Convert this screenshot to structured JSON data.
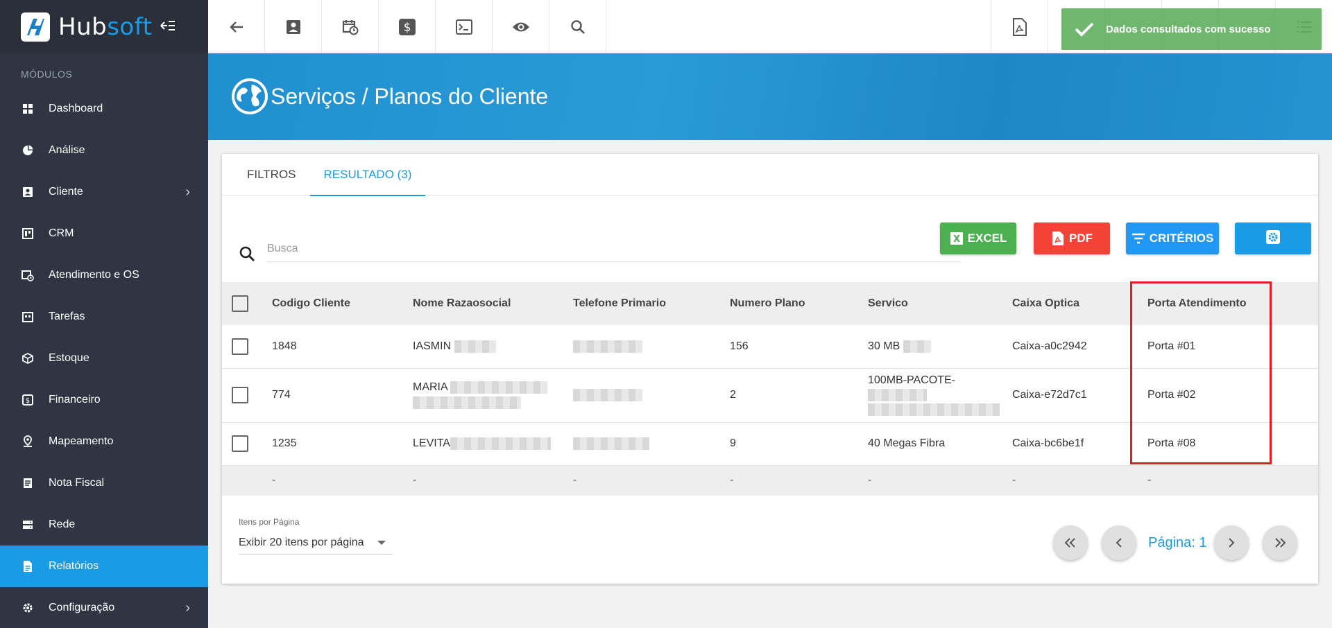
{
  "brand": {
    "hub": "Hub",
    "soft": "soft"
  },
  "sidebar": {
    "section_title": "MÓDULOS",
    "items": [
      {
        "label": "Dashboard",
        "icon": "dashboard-icon"
      },
      {
        "label": "Análise",
        "icon": "pie-chart-icon"
      },
      {
        "label": "Cliente",
        "icon": "contact-card-icon",
        "has_submenu": true
      },
      {
        "label": "CRM",
        "icon": "crm-board-icon"
      },
      {
        "label": "Atendimento e OS",
        "icon": "calendar-clock-icon"
      },
      {
        "label": "Tarefas",
        "icon": "tasks-icon"
      },
      {
        "label": "Estoque",
        "icon": "box-icon"
      },
      {
        "label": "Financeiro",
        "icon": "money-icon"
      },
      {
        "label": "Mapeamento",
        "icon": "map-pin-icon"
      },
      {
        "label": "Nota Fiscal",
        "icon": "invoice-icon"
      },
      {
        "label": "Rede",
        "icon": "server-icon"
      },
      {
        "label": "Relatórios",
        "icon": "report-icon",
        "active": true
      },
      {
        "label": "Configuração",
        "icon": "gear-icon",
        "has_submenu": true
      }
    ]
  },
  "toast": {
    "message": "Dados consultados com sucesso"
  },
  "banner": {
    "title": "Serviços / Planos do Cliente"
  },
  "tabs": [
    {
      "label": "FILTROS",
      "active": false
    },
    {
      "label": "RESULTADO (3)",
      "active": true
    }
  ],
  "search": {
    "placeholder": "Busca"
  },
  "actions": {
    "excel": "EXCEL",
    "pdf": "PDF",
    "criterios": "CRITÉRIOS"
  },
  "table": {
    "columns": [
      "Codigo Cliente",
      "Nome Razaosocial",
      "Telefone Primario",
      "Numero Plano",
      "Servico",
      "Caixa Optica",
      "Porta Atendimento"
    ],
    "rows": [
      {
        "codigo": "1848",
        "nome": "IASMIN",
        "telefone": "",
        "plano": "156",
        "servico": "30 MB",
        "caixa": "Caixa-a0c2942",
        "porta": "Porta #01"
      },
      {
        "codigo": "774",
        "nome": "MARIA",
        "telefone": "",
        "plano": "2",
        "servico": "100MB-PACOTE-",
        "caixa": "Caixa-e72d7c1",
        "porta": "Porta #02"
      },
      {
        "codigo": "1235",
        "nome": "LEVITA",
        "telefone": "",
        "plano": "9",
        "servico": "40 Megas Fibra",
        "caixa": "Caixa-bc6be1f",
        "porta": "Porta #08"
      }
    ],
    "footer": [
      "-",
      "-",
      "-",
      "-",
      "-",
      "-",
      "-"
    ]
  },
  "pagination": {
    "items_label": "Itens por Página",
    "items_value": "Exibir 20 itens por página",
    "page_label": "Página: 1"
  },
  "colors": {
    "accent": "#1a9be6",
    "sidebar": "#2f3542",
    "excel": "#4caf50",
    "pdf": "#f44336",
    "highlight": "#e31b23"
  }
}
